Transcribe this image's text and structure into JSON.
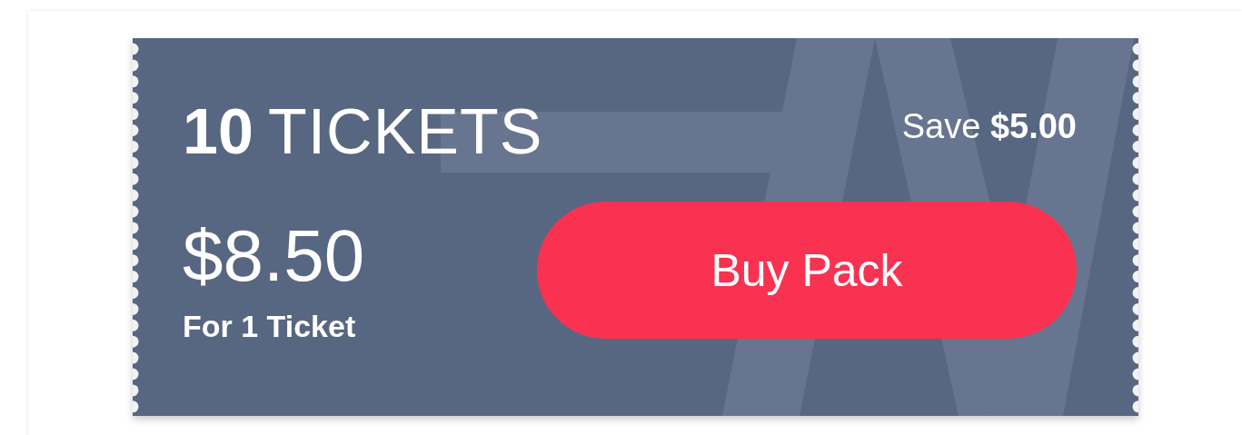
{
  "ticket_pack": {
    "count": "10",
    "unit": "TICKETS",
    "savings": "Save **$5.00**",
    "price": "$8.50",
    "price_note": "For 1 Ticket",
    "button": "Buy Pack"
  }
}
